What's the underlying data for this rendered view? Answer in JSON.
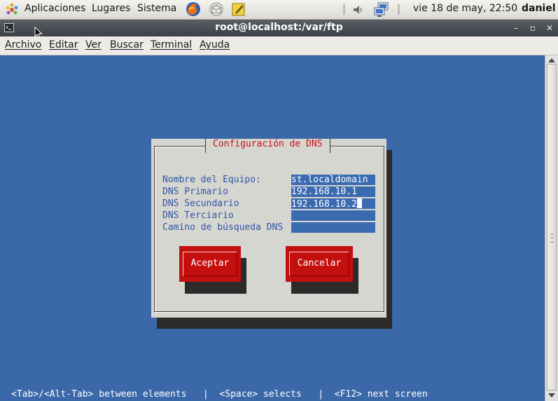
{
  "top_panel": {
    "applications": "Aplicaciones",
    "places": "Lugares",
    "system": "Sistema",
    "launchers": [
      "firefox-icon",
      "mail-icon",
      "notes-icon"
    ],
    "tray_icons": [
      "volume-icon",
      "network-icon"
    ],
    "clock": "vie 18 de may, 22:50",
    "user": "daniel"
  },
  "window": {
    "title": "root@localhost:/var/ftp",
    "minimize": "–",
    "maximize": "▫",
    "close": "✕"
  },
  "menu": {
    "items": [
      "Archivo",
      "Editar",
      "Ver",
      "Buscar",
      "Terminal",
      "Ayuda"
    ]
  },
  "dialog": {
    "title": "Configuración de DNS",
    "fields": [
      {
        "label": "Nombre del Equipo:",
        "value": "st.localdomain"
      },
      {
        "label": "DNS Primario",
        "value": "192.168.10.1"
      },
      {
        "label": "DNS Secundario",
        "value": "192.168.10.2"
      },
      {
        "label": "DNS Terciario",
        "value": ""
      },
      {
        "label": "Camino de búsqueda DNS",
        "value": ""
      }
    ],
    "ok_button": "Aceptar",
    "cancel_button": "Cancelar"
  },
  "status_line": "<Tab>/<Alt-Tab> between elements   |  <Space> selects   |  <F12> next screen",
  "colors": {
    "terminal_bg": "#3a68a8",
    "dialog_bg": "#d6d6d0",
    "dialog_title": "#c61212",
    "label": "#2f55a6",
    "field_bg": "#3a6ab0",
    "button_bg": "#c40f0f"
  }
}
